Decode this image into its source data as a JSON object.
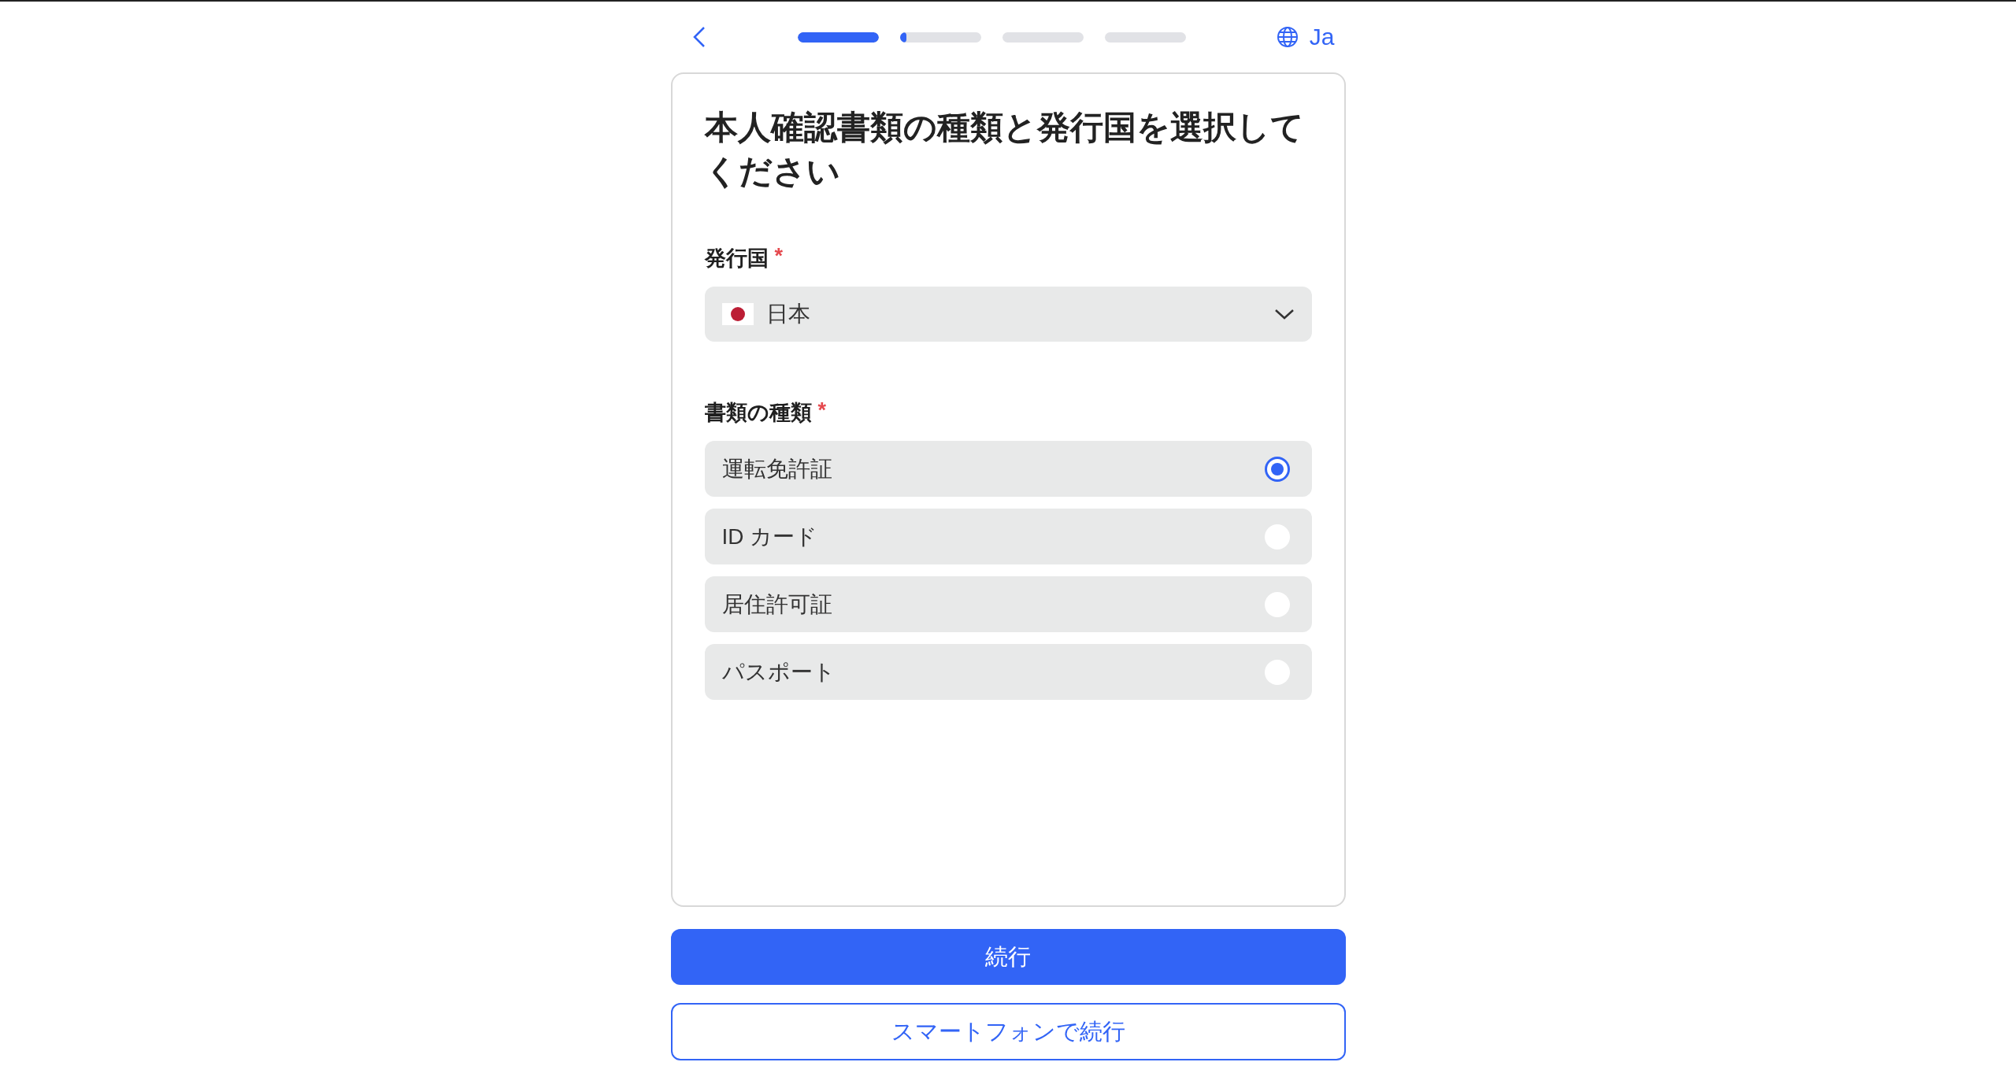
{
  "header": {
    "language": "Ja",
    "steps": [
      {
        "level": 1
      },
      {
        "level": 0.08
      },
      {
        "level": 0
      },
      {
        "level": 0
      }
    ]
  },
  "title": "本人確認書類の種類と発行国を選択してください",
  "country": {
    "label": "発行国",
    "required_mark": "*",
    "value": "日本"
  },
  "document_type": {
    "label": "書類の種類",
    "required_mark": "*",
    "options": [
      {
        "label": "運転免許証",
        "selected": true
      },
      {
        "label": "ID カード",
        "selected": false
      },
      {
        "label": "居住許可証",
        "selected": false
      },
      {
        "label": "パスポート",
        "selected": false
      }
    ]
  },
  "buttons": {
    "primary": "続行",
    "secondary": "スマートフォンで続行"
  }
}
